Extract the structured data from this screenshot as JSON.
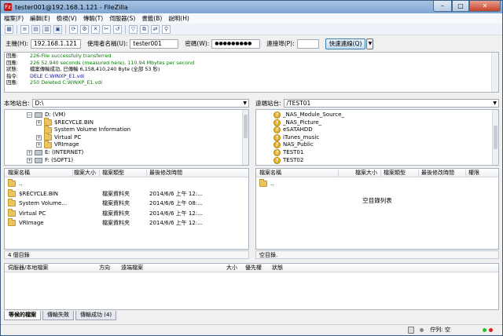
{
  "window": {
    "title": "tester001@192.168.1.121 - FileZilla",
    "app_icon": "Fz",
    "min": "–",
    "max": "□",
    "close": "✕"
  },
  "menu": [
    "檔案(F)",
    "編輯(E)",
    "檢視(V)",
    "傳輸(T)",
    "伺服器(S)",
    "書籤(B)",
    "說明(H)"
  ],
  "toolbar": [
    "site-manager-icon",
    "toggle-log-icon",
    "toggle-local-tree-icon",
    "toggle-remote-tree-icon",
    "toggle-queue-icon",
    "refresh-icon",
    "process-queue-icon",
    "cancel-icon",
    "disconnect-icon",
    "reconnect-icon",
    "filter-icon",
    "compare-icon",
    "sync-browse-icon",
    "search-icon"
  ],
  "toolbar_glyphs": [
    "▦",
    "≡",
    "▤",
    "▥",
    "▣",
    "⟳",
    "⚙",
    "✕",
    "✂",
    "↺",
    "▽",
    "⧉",
    "⇄",
    "⚲"
  ],
  "quickconnect": {
    "host_label": "主機(H):",
    "host": "192.168.1.121",
    "user_label": "使用者名稱(U):",
    "user": "tester001",
    "pass_label": "密碼(W):",
    "pass": "●●●●●●●●●",
    "port_label": "連接埠(P):",
    "port": "",
    "button": "快速連線(Q)",
    "dropdown": "▼"
  },
  "log": [
    {
      "k": "回應:",
      "v": "226-File successfully transferred",
      "c": "green"
    },
    {
      "k": "回應:",
      "v": "226 52.940 seconds (measured here), 110.94 Mbytes per second",
      "c": "green"
    },
    {
      "k": "狀態:",
      "v": "檔案傳輸成功, 已傳輸 6,158,410,240 Byte (全部 53 秒)",
      "c": "black"
    },
    {
      "k": "指令:",
      "v": "DELE C:WINXP_E1.vdi",
      "c": "blue"
    },
    {
      "k": "回應:",
      "v": "250 Deleted C:WINXP_E1.vdi",
      "c": "green"
    }
  ],
  "local": {
    "site_label": "本地站台:",
    "path": "D:\\",
    "drop": "▼",
    "tree": [
      {
        "label": "D: (VM)",
        "icon": "drive",
        "exp": "−",
        "indent": 0
      },
      {
        "label": "$RECYCLE.BIN",
        "icon": "folder",
        "exp": "+",
        "indent": 1
      },
      {
        "label": "System Volume Information",
        "icon": "folder",
        "exp": "",
        "indent": 1
      },
      {
        "label": "Virtual PC",
        "icon": "folder",
        "exp": "+",
        "indent": 1
      },
      {
        "label": "VRImage",
        "icon": "folder",
        "exp": "+",
        "indent": 1
      },
      {
        "label": "E: (INTERNET)",
        "icon": "drive",
        "exp": "+",
        "indent": 0
      },
      {
        "label": "F: (SOFT1)",
        "icon": "drive",
        "exp": "+",
        "indent": 0
      }
    ],
    "columns": [
      "檔案名稱",
      "檔案大小",
      "檔案類型",
      "最後修改時間"
    ],
    "files": [
      {
        "name": "..",
        "size": "",
        "type": "",
        "modified": ""
      },
      {
        "name": "$RECYCLE.BIN",
        "size": "",
        "type": "檔案資料夾",
        "modified": "2014/6/6 上午 12:..."
      },
      {
        "name": "System Volume...",
        "size": "",
        "type": "檔案資料夾",
        "modified": "2014/6/6 上午 08:..."
      },
      {
        "name": "Virtual PC",
        "size": "",
        "type": "檔案資料夾",
        "modified": "2014/6/6 上午 12:..."
      },
      {
        "name": "VRImage",
        "size": "",
        "type": "檔案資料夾",
        "modified": "2014/6/6 上午 12:..."
      }
    ],
    "status": "4 個目錄"
  },
  "remote": {
    "site_label": "遠端站台:",
    "path": "/TEST01",
    "drop": "▼",
    "tree": [
      {
        "label": "_NAS_Module_Source_"
      },
      {
        "label": "_NAS_Picture_"
      },
      {
        "label": "eSATAHDD"
      },
      {
        "label": "iTunes_music"
      },
      {
        "label": "NAS_Public"
      },
      {
        "label": "TEST01"
      },
      {
        "label": "TEST02"
      }
    ],
    "tree_mark": "?",
    "columns": [
      "檔案名稱",
      "檔案大小",
      "檔案類型",
      "最後修改時間",
      "權限"
    ],
    "files": [
      {
        "name": ".."
      }
    ],
    "empty_text": "空目錄列表",
    "status": "空目錄."
  },
  "queue": {
    "columns": [
      "伺服器/本地檔案",
      "方向",
      "遠端檔案",
      "大小",
      "優先權",
      "狀態"
    ],
    "tabs": [
      "等候的檔案",
      "傳輸失敗",
      "傳輸成功 (4)"
    ]
  },
  "bottom": {
    "queue_status": "佇列: 空"
  },
  "colors": {
    "led_green": "#2bbf2b",
    "led_red": "#d32323",
    "log_green": "#067b06",
    "log_blue": "#13139a"
  }
}
